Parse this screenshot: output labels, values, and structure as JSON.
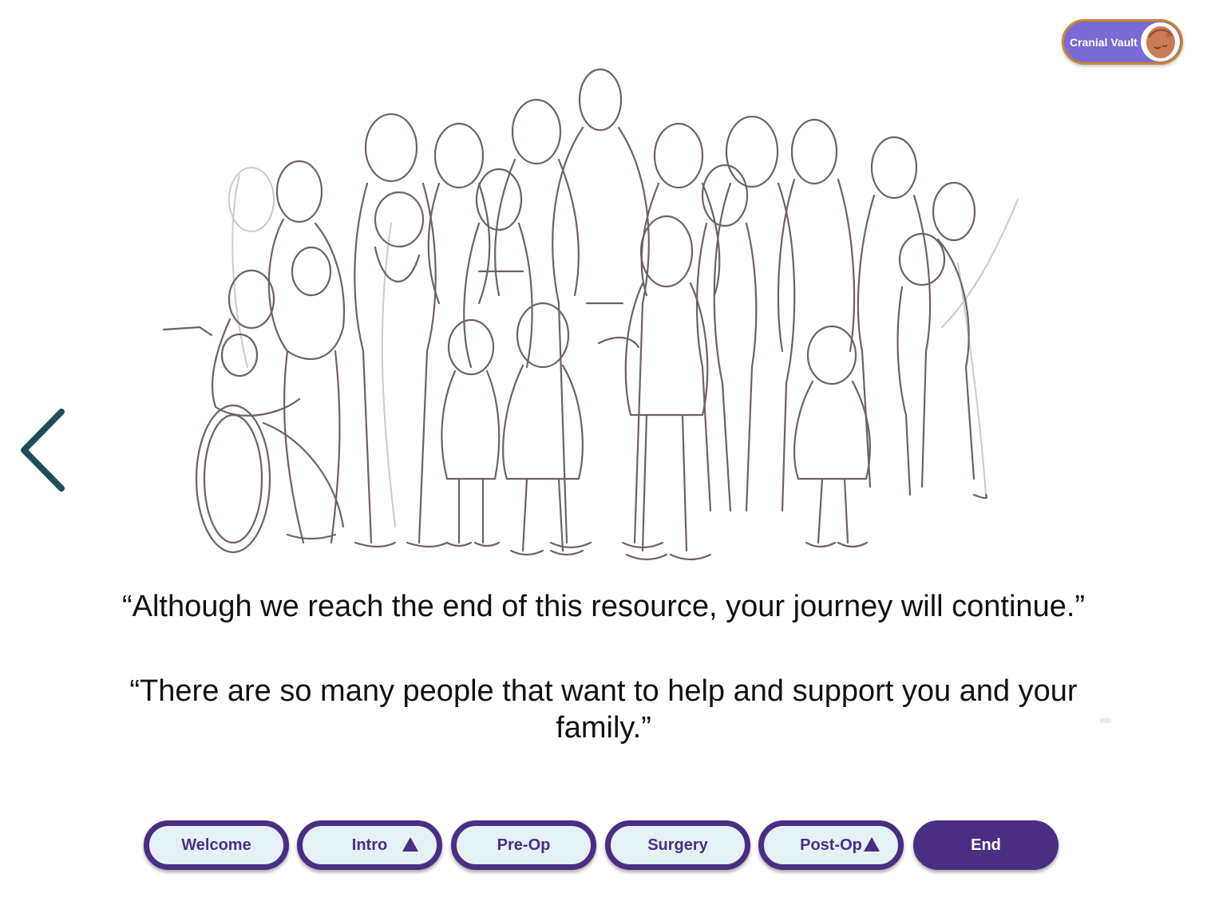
{
  "module_toggle": {
    "label": "Cranial Vault",
    "icon": "baby-head-icon",
    "colors": {
      "fill": "#7a6ad3",
      "border": "#c8872a"
    }
  },
  "navigation": {
    "back_icon": "chevron-left-icon",
    "back_color": "#1f4e5a"
  },
  "illustration": {
    "icon": "community-group-sketch"
  },
  "quotes": [
    "“Although we reach the end of this resource, your journey will continue.”",
    "“There are so many people that want to help and support you and your family.”"
  ],
  "bottom_nav": {
    "colors": {
      "primary": "#4b2e83",
      "button_fill": "#e4f1f5"
    },
    "items": [
      {
        "label": "Welcome",
        "active": false,
        "caret": false
      },
      {
        "label": "Intro",
        "active": false,
        "caret": true
      },
      {
        "label": "Pre-Op",
        "active": false,
        "caret": false
      },
      {
        "label": "Surgery",
        "active": false,
        "caret": false
      },
      {
        "label": "Post-Op",
        "active": false,
        "caret": true
      },
      {
        "label": "End",
        "active": true,
        "caret": false
      }
    ]
  }
}
